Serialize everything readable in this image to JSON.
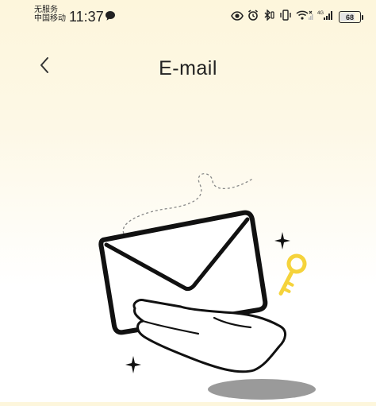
{
  "status_bar": {
    "carrier_line1": "无服务",
    "carrier_line2": "中国移动",
    "time": "11:37",
    "network_label": "4G",
    "battery_level": "68",
    "icons": [
      "message-icon",
      "eye-icon",
      "alarm-icon",
      "bluetooth-icon",
      "vibrate-icon",
      "wifi-icon",
      "signal-icon",
      "battery-icon"
    ]
  },
  "header": {
    "title": "E-mail",
    "back_icon": "chevron-left-icon"
  },
  "illustration": {
    "name": "envelope-on-hand-with-key",
    "accent_color": "#f5d33b",
    "shadow_color": "#9a9a9a"
  }
}
